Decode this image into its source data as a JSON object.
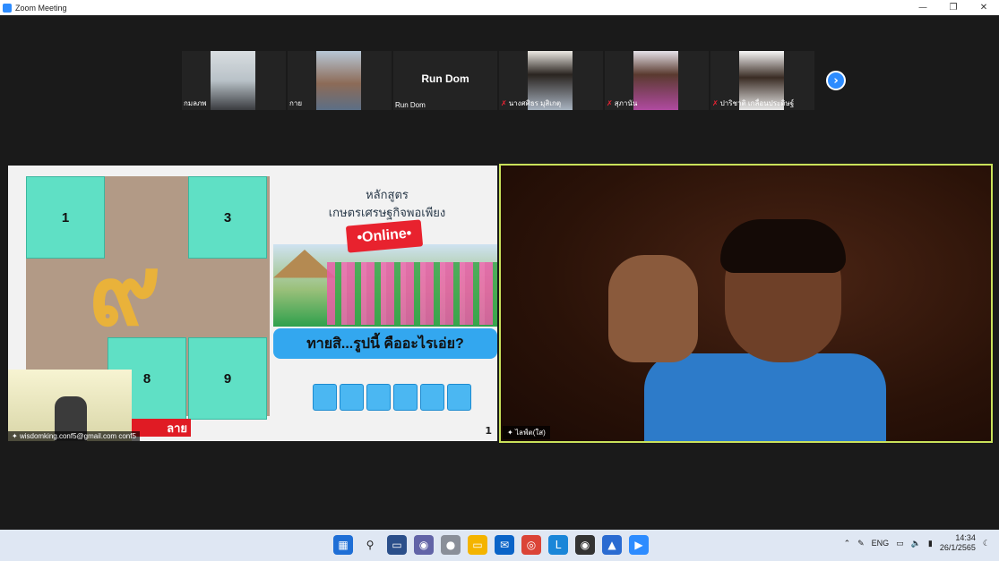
{
  "window": {
    "title": "Zoom Meeting"
  },
  "participants": [
    {
      "name": "กมลภพ",
      "muted": false,
      "video": true,
      "tone": "#c8d2d8"
    },
    {
      "name": "กาย",
      "muted": false,
      "video": true,
      "tone": "#9fb0c2"
    },
    {
      "name": "Run Dom",
      "display": "Run Dom",
      "muted": false,
      "video": false
    },
    {
      "name": "นางศศิธร มุสิเกตุ",
      "muted": true,
      "video": true,
      "tone": "#e6e2dc"
    },
    {
      "name": "สุภานัน",
      "muted": true,
      "video": true,
      "tone": "#d9a9c4"
    },
    {
      "name": "ปาริชาติ เกลื่อนประดิษฐ์",
      "muted": true,
      "video": true,
      "tone": "#f0f0f0"
    }
  ],
  "share": {
    "cells": [
      "1",
      "3",
      "8",
      "9"
    ],
    "glyph": "๙",
    "heading_line1": "หลักสูตร",
    "heading_line2": "เกษตรเศรษฐกิจพอเพียง",
    "online": "•Online•",
    "question": "ทายสิ...รูปนี้ คืออะไรเอ่ย?",
    "answer_boxes": 6,
    "slide_number": "1",
    "red_bar_text": "ลาย",
    "thumb_label": "wisdomking.conf5@gmail.com conf5"
  },
  "speaker": {
    "name": "ไลฟ์ต(ใส)"
  },
  "taskbar": {
    "language": "ENG",
    "time": "14:34",
    "date": "26/1/2565"
  },
  "colors": {
    "accent": "#2d8cff",
    "active_border": "#c9e15a"
  }
}
